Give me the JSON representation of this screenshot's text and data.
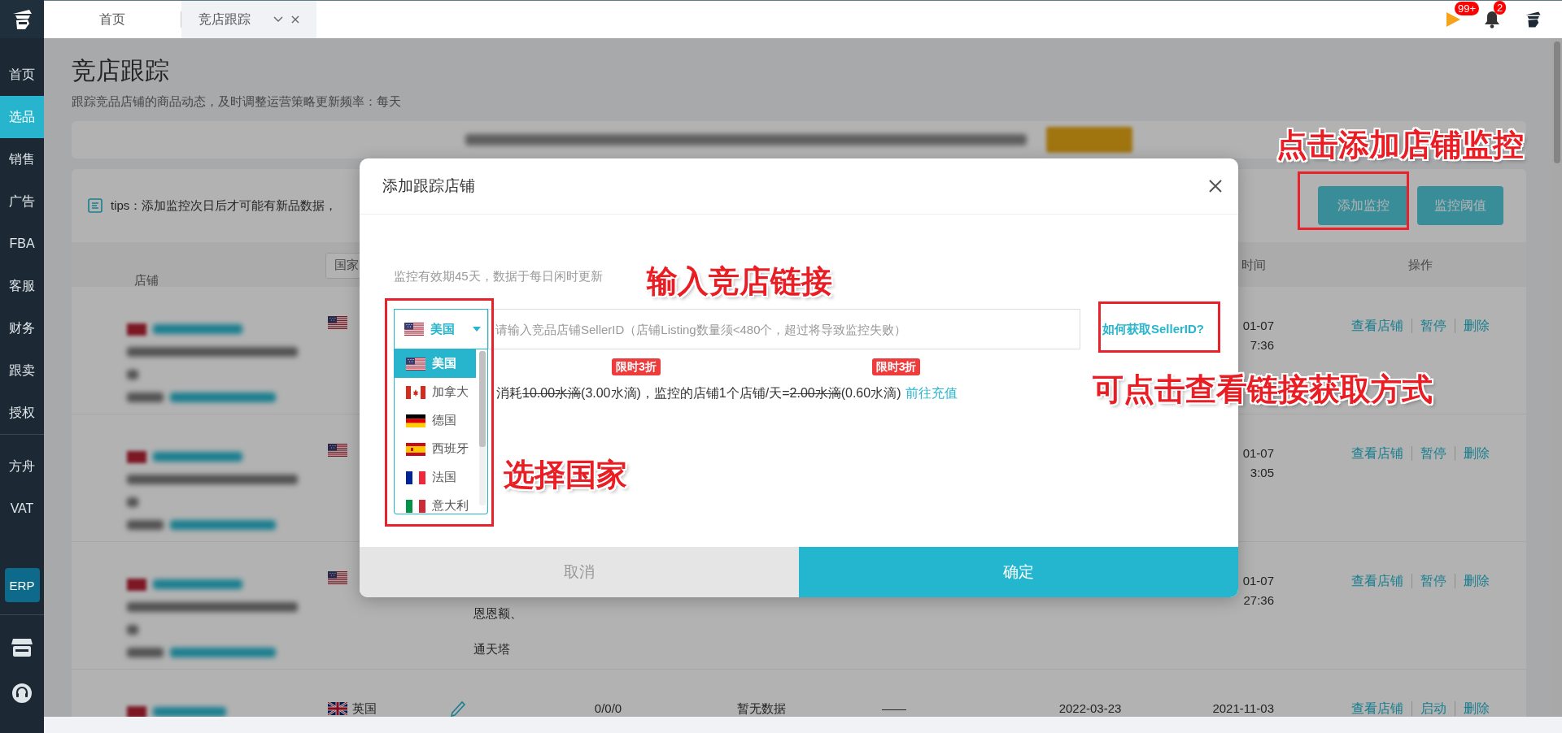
{
  "top_bar": {
    "tabs": [
      {
        "label": "首页",
        "selected": false
      },
      {
        "label": "竞店跟踪",
        "selected": true
      }
    ],
    "alerts": [
      {
        "kind": "flag",
        "badge": "99+"
      },
      {
        "kind": "bell",
        "badge": "2"
      }
    ]
  },
  "sidebar": {
    "items": [
      {
        "label": "首页",
        "selected": false
      },
      {
        "label": "选品",
        "selected": true
      },
      {
        "label": "销售",
        "selected": false
      },
      {
        "label": "广告",
        "selected": false
      },
      {
        "label": "FBA",
        "selected": false
      },
      {
        "label": "客服",
        "selected": false
      },
      {
        "label": "财务",
        "selected": false
      },
      {
        "label": "跟卖",
        "selected": false
      },
      {
        "label": "授权",
        "selected": false
      }
    ],
    "extra_items": [
      {
        "label": "方舟",
        "selected": false
      },
      {
        "label": "VAT",
        "selected": false
      }
    ],
    "erp_button": "ERP"
  },
  "page": {
    "title": "竞店跟踪",
    "subtitle": "跟踪竞品店铺的商品动态，及时调整运营策略更新频率：每天",
    "tips": "tips：添加监控次日后才可能有新品数据，",
    "buttons": [
      "添加监控",
      "监控阈值"
    ]
  },
  "table": {
    "columns": [
      {
        "label": "店铺",
        "kind": "text"
      },
      {
        "label": "国家",
        "kind": "select"
      },
      {
        "label": "时间",
        "kind": "text"
      },
      {
        "label": "操作",
        "kind": "text"
      }
    ],
    "rows": [
      {
        "country": {
          "kind": "us"
        },
        "column_8": [
          "01-07",
          "7:36"
        ],
        "actions": [
          "查看店铺",
          "暂停",
          "删除"
        ]
      },
      {
        "country": {
          "kind": "us"
        },
        "column_8": [
          "01-07",
          "3:05"
        ],
        "actions": [
          "查看店铺",
          "暂停",
          "删除"
        ]
      },
      {
        "country": {
          "kind": "us"
        },
        "column_3": {
          "kind": "lines",
          "lines": [
            "恩恩额、",
            "通天塔"
          ]
        },
        "column_8": [
          "01-07",
          "27:36"
        ],
        "actions": [
          "查看店铺",
          "暂停",
          "删除"
        ]
      },
      {
        "country": {
          "kind": "gb",
          "label": "英国"
        },
        "column_3": {
          "kind": "edit"
        },
        "column_4": "0/0/0",
        "column_5": "暂无数据",
        "column_6": "——",
        "column_7": [
          "2022-03-23"
        ],
        "column_8": [
          "2021-11-03"
        ],
        "actions": [
          "查看店铺",
          "启动",
          "删除"
        ]
      }
    ]
  },
  "modal": {
    "title": "添加跟踪店铺",
    "note": "监控有效期45天，数据于每日闲时更新",
    "country_select": {
      "value": {
        "kind": "us",
        "label": "美国"
      },
      "expanded": true,
      "options": [
        {
          "label": "美国",
          "kind": "us",
          "selected": true
        },
        {
          "label": "加拿大",
          "kind": "ca",
          "selected": false
        },
        {
          "label": "德国",
          "kind": "de",
          "selected": false
        },
        {
          "label": "西班牙",
          "kind": "es",
          "selected": false
        },
        {
          "label": "法国",
          "kind": "fr",
          "selected": false
        },
        {
          "label": "意大利",
          "kind": "it",
          "selected": false
        }
      ]
    },
    "seller_id": {
      "placeholder": "请输入竞品店铺SellerID（店铺Listing数量须<480个，超过将导致监控失败）"
    },
    "help_link": "如何获取SellerID?",
    "pricing": {
      "segments": [
        {
          "text": "消耗",
          "struck": false
        },
        {
          "text": "10.00水滴",
          "struck": true
        },
        {
          "text": "(3.00水滴)",
          "struck": false,
          "badge": "限时3折"
        },
        {
          "text": "，监控的店铺1个店铺/天=",
          "struck": false
        },
        {
          "text": "2.00水滴",
          "struck": true
        },
        {
          "text": "(0.60水滴)",
          "struck": false,
          "badge": "限时3折"
        }
      ],
      "link": "前往充值"
    },
    "buttons": [
      {
        "label": "取消",
        "kind": "secondary"
      },
      {
        "label": "确定",
        "kind": "primary"
      }
    ]
  },
  "annotations": [
    "点击添加店铺监控",
    "输入竞店链接",
    "选择国家",
    "可点击查看链接获取方式"
  ]
}
